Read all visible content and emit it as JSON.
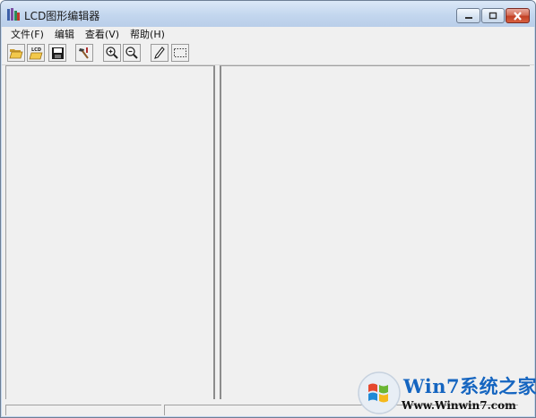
{
  "window": {
    "title": "LCD图形编辑器"
  },
  "menubar": {
    "items": [
      {
        "label": "文件(F)"
      },
      {
        "label": "编辑"
      },
      {
        "label": "查看(V)"
      },
      {
        "label": "帮助(H)"
      }
    ]
  },
  "toolbar": {
    "buttons": [
      {
        "name": "open-folder-button",
        "icon": "open-folder-icon"
      },
      {
        "name": "open-lcd-button",
        "icon": "lcd-folder-icon",
        "icon_label": "LCD"
      },
      {
        "name": "save-button",
        "icon": "floppy-disk-icon"
      },
      {
        "name": "tools-button",
        "icon": "hammer-icon"
      },
      {
        "name": "zoom-in-button",
        "icon": "zoom-in-icon"
      },
      {
        "name": "zoom-out-button",
        "icon": "zoom-out-icon"
      },
      {
        "name": "pencil-button",
        "icon": "pencil-icon"
      },
      {
        "name": "select-rect-button",
        "icon": "dotted-rect-icon"
      }
    ]
  },
  "watermark": {
    "line1": "Win7系统之家",
    "line2": "Www.Winwin7.com"
  },
  "colors": {
    "title_bar": "#c5d7ec",
    "close_button": "#c94a30",
    "client": "#f0f0f0",
    "watermark_blue": "#1565c0"
  }
}
